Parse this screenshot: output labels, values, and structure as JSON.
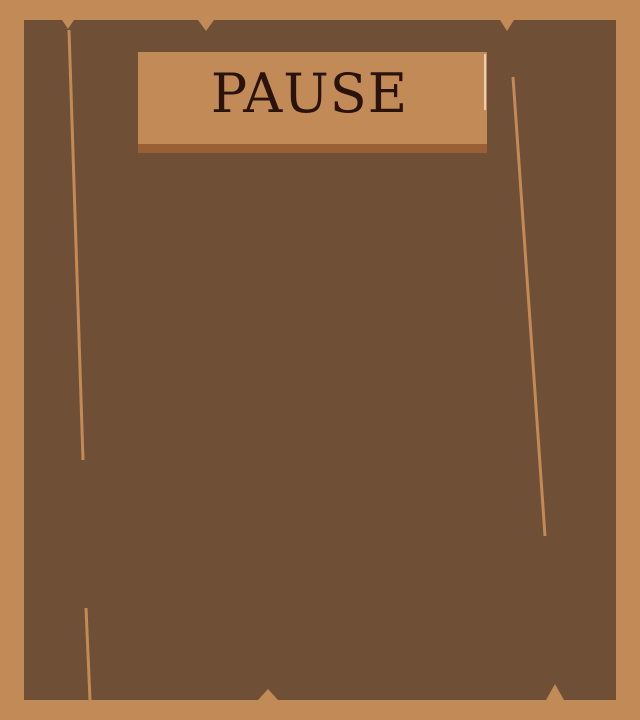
{
  "pause_menu": {
    "title": "PAUSE"
  },
  "colors": {
    "frame": "#c28a56",
    "panel": "#6f4f35",
    "plank": "#c28a56",
    "plank_shadow": "#9b5f35",
    "title_text": "#2a130c",
    "crack_lines": "#c28a56"
  }
}
